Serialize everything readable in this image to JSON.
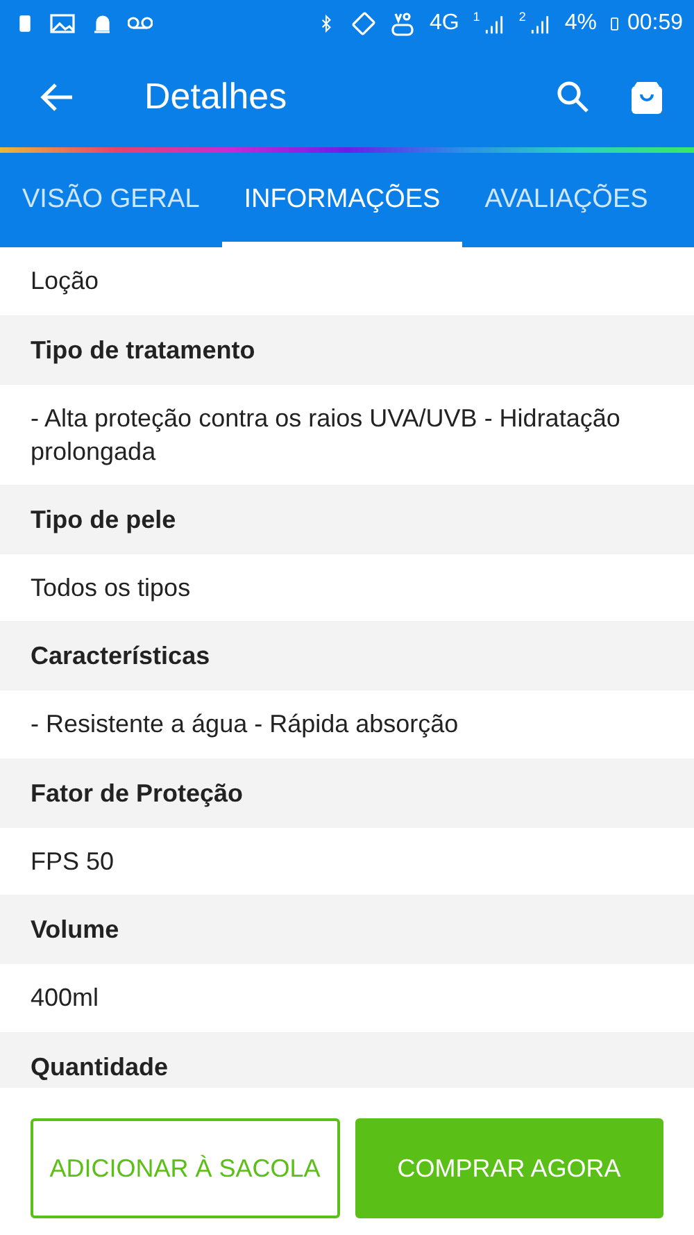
{
  "status_bar": {
    "network": "4G",
    "sims": [
      {
        "label": "1"
      },
      {
        "label": "2"
      }
    ],
    "battery": "4%",
    "time": "00:59"
  },
  "app_bar": {
    "title": "Detalhes"
  },
  "tabs": [
    {
      "label": "VISÃO GERAL",
      "selected": false
    },
    {
      "label": "INFORMAÇÕES",
      "selected": true
    },
    {
      "label": "AVALIAÇÕES",
      "selected": false
    }
  ],
  "rows": [
    {
      "kind": "value",
      "text": "Loção"
    },
    {
      "kind": "heading",
      "text": "Tipo de tratamento"
    },
    {
      "kind": "value",
      "text": "- Alta proteção contra os raios UVA/UVB - Hidratação prolongada"
    },
    {
      "kind": "heading",
      "text": "Tipo de pele"
    },
    {
      "kind": "value",
      "text": "Todos os tipos"
    },
    {
      "kind": "heading",
      "text": "Características"
    },
    {
      "kind": "value",
      "text": "- Resistente a água - Rápida absorção"
    },
    {
      "kind": "heading",
      "text": "Fator de Proteção"
    },
    {
      "kind": "value",
      "text": "FPS 50"
    },
    {
      "kind": "heading",
      "text": "Volume"
    },
    {
      "kind": "value",
      "text": "400ml"
    },
    {
      "kind": "heading",
      "text": "Quantidade"
    }
  ],
  "buttons": [
    {
      "kind": "outline",
      "label": "ADICIONAR À SACOLA"
    },
    {
      "kind": "filled",
      "label": "COMPRAR AGORA"
    }
  ]
}
